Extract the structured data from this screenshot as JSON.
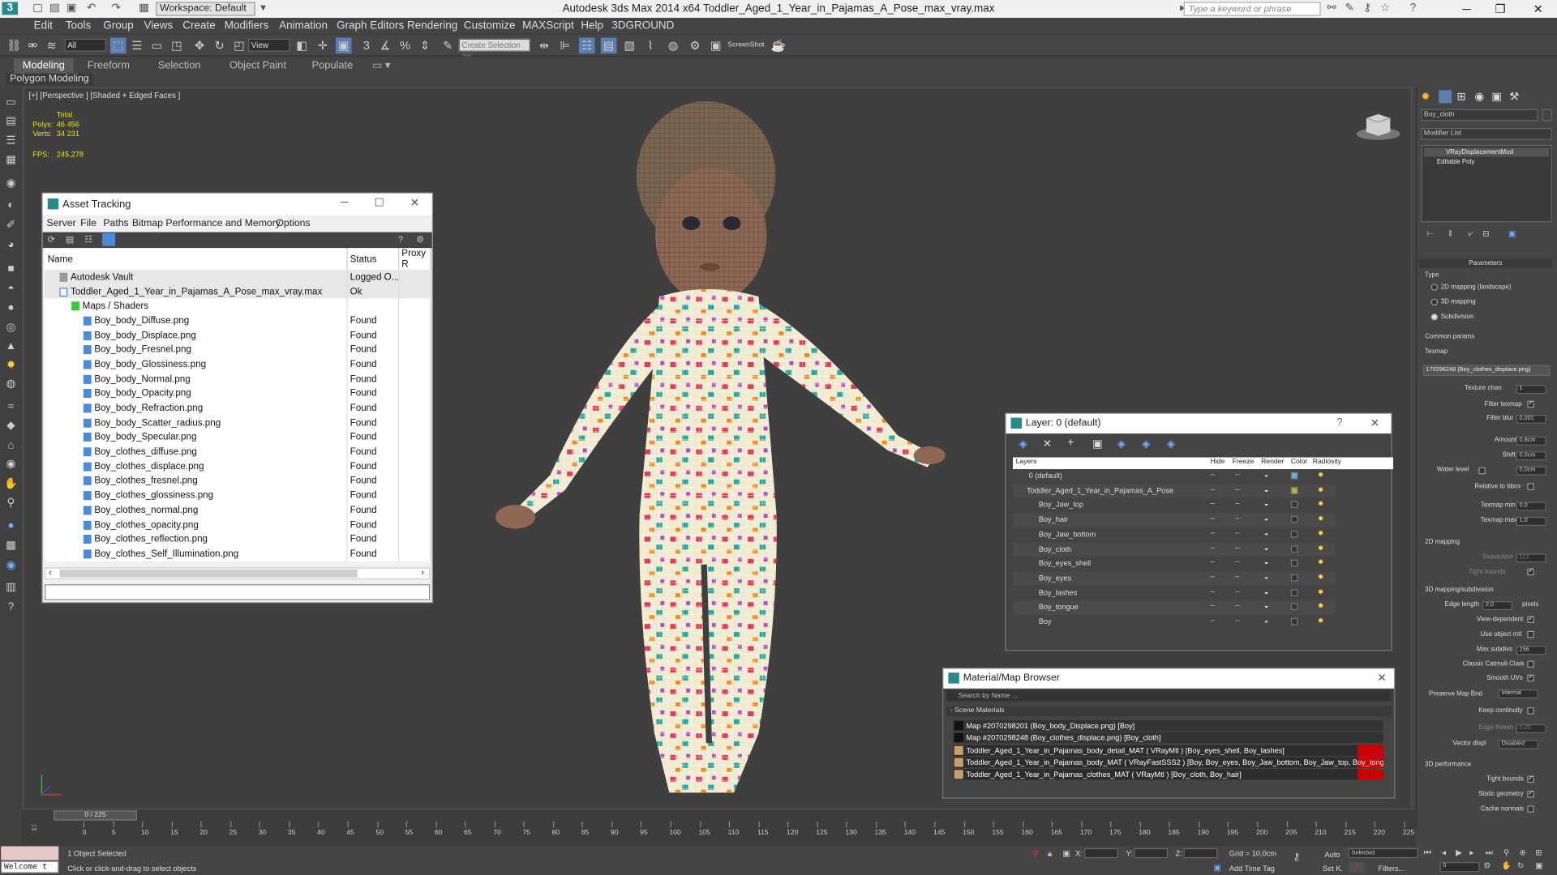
{
  "app": {
    "title": "Autodesk 3ds Max  2014 x64    Toddler_Aged_1_Year_in_Pajamas_A_Pose_max_vray.max",
    "workspace": "Workspace: Default",
    "search_placeholder": "Type a keyword or phrase"
  },
  "menu": [
    "Edit",
    "Tools",
    "Group",
    "Views",
    "Create",
    "Modifiers",
    "Animation",
    "Graph Editors",
    "Rendering",
    "Customize",
    "MAXScript",
    "Help",
    "3DGROUND"
  ],
  "toolbar": {
    "filter": "All",
    "refcoord": "View",
    "selset": "Create Selection Se",
    "screenshot": "ScreenShot"
  },
  "ribbon": {
    "tabs": [
      "Modeling",
      "Freeform",
      "Selection",
      "Object Paint",
      "Populate"
    ],
    "active": "Modeling",
    "sub": "Polygon Modeling"
  },
  "viewport": {
    "label": "[+] [Perspective ] [Shaded + Edged Faces ]",
    "stats": {
      "total": "Total",
      "polys_label": "Polys:",
      "polys": "46 456",
      "verts_label": "Verts:",
      "verts": "34 231",
      "fps_label": "FPS:",
      "fps": "245,278"
    }
  },
  "asset": {
    "title": "Asset Tracking",
    "menu": [
      "Server",
      "File",
      "Paths",
      "Bitmap Performance and Memory",
      "Options"
    ],
    "columns": [
      "Name",
      "Status",
      "Proxy R"
    ],
    "rows": [
      {
        "name": "Autodesk Vault",
        "status": "Logged O...",
        "indent": 1
      },
      {
        "name": "Toddler_Aged_1_Year_in_Pajamas_A_Pose_max_vray.max",
        "status": "Ok",
        "indent": 2
      },
      {
        "name": "Maps / Shaders",
        "status": "",
        "indent": 3
      },
      {
        "name": "Boy_body_Diffuse.png",
        "status": "Found",
        "indent": 4
      },
      {
        "name": "Boy_body_Displace.png",
        "status": "Found",
        "indent": 4
      },
      {
        "name": "Boy_body_Fresnel.png",
        "status": "Found",
        "indent": 4
      },
      {
        "name": "Boy_body_Glossiness.png",
        "status": "Found",
        "indent": 4
      },
      {
        "name": "Boy_body_Normal.png",
        "status": "Found",
        "indent": 4
      },
      {
        "name": "Boy_body_Opacity.png",
        "status": "Found",
        "indent": 4
      },
      {
        "name": "Boy_body_Refraction.png",
        "status": "Found",
        "indent": 4
      },
      {
        "name": "Boy_body_Scatter_radius.png",
        "status": "Found",
        "indent": 4
      },
      {
        "name": "Boy_body_Specular.png",
        "status": "Found",
        "indent": 4
      },
      {
        "name": "Boy_clothes_diffuse.png",
        "status": "Found",
        "indent": 4
      },
      {
        "name": "Boy_clothes_displace.png",
        "status": "Found",
        "indent": 4
      },
      {
        "name": "Boy_clothes_fresnel.png",
        "status": "Found",
        "indent": 4
      },
      {
        "name": "Boy_clothes_glossiness.png",
        "status": "Found",
        "indent": 4
      },
      {
        "name": "Boy_clothes_normal.png",
        "status": "Found",
        "indent": 4
      },
      {
        "name": "Boy_clothes_opacity.png",
        "status": "Found",
        "indent": 4
      },
      {
        "name": "Boy_clothes_reflection.png",
        "status": "Found",
        "indent": 4
      },
      {
        "name": "Boy_clothes_Self_Illumination.png",
        "status": "Found",
        "indent": 4
      }
    ]
  },
  "layer": {
    "title": "Layer: 0 (default)",
    "cols": [
      "Layers",
      "Hide",
      "Freeze",
      "Render",
      "Color",
      "Radiosity"
    ],
    "rows": [
      "0 (default)",
      "Toddler_Aged_1_Year_in_Pajamas_A_Pose",
      "Boy_Jaw_top",
      "Boy_hair",
      "Boy_Jaw_bottom",
      "Boy_cloth",
      "Boy_eyes_shell",
      "Boy_eyes",
      "Boy_lashes",
      "Boy_tongue",
      "Boy"
    ]
  },
  "matbrowser": {
    "title": "Material/Map Browser",
    "search": "Search by Name ...",
    "section": "- Scene Materials",
    "items": [
      "Map #2070298201 (Boy_body_Displace.png) [Boy]",
      "Map #2070298248 (Boy_clothes_displace.png) [Boy_cloth]",
      "Toddler_Aged_1_Year_in_Pajamas_body_detail_MAT ( VRayMtl ) [Boy_eyes_shell, Boy_lashes]",
      "Toddler_Aged_1_Year_in_Pajamas_body_MAT ( VRayFastSSS2 ) [Boy, Boy_eyes, Boy_Jaw_bottom, Boy_Jaw_top, Boy_tongue]",
      "Toddler_Aged_1_Year_in_Pajamas_clothes_MAT ( VRayMtl ) [Boy_cloth, Boy_hair]"
    ]
  },
  "cmdpanel": {
    "objname": "Boy_cloth",
    "modlist": "Modifier List",
    "stack": [
      "VRayDisplacementMod",
      "Editable Poly"
    ],
    "params": "Parameters",
    "type": "Type",
    "type_opts": [
      "2D mapping (landscape)",
      "3D mapping",
      "Subdivision"
    ],
    "common": "Common params",
    "texmap": "Texmap",
    "texmap_val": "170298248 (Boy_clothes_displace.png)",
    "texchan": "Texture chan",
    "texchan_val": "1",
    "filtertex": "Filter texmap",
    "filterblur": "Filter blur",
    "filterblur_val": "0,001",
    "amount": "Amount",
    "amount_val": "0,8cm",
    "shift": "Shift",
    "shift_val": "0,0cm",
    "waterlevel": "Water level",
    "waterlevel_val": "0,0cm",
    "relbbox": "Relative to bbox",
    "texmin": "Texmap min",
    "texmin_val": "0,0",
    "texmax": "Texmap max",
    "texmax_val": "1,0",
    "map2d": "2D mapping",
    "resolution": "Resolution",
    "resolution_val": "512",
    "tight": "Tight bounds",
    "map3d": "3D mapping/subdivision",
    "edgelen": "Edge length",
    "edgelen_val": "2,0",
    "pixels": "pixels",
    "viewdep": "View-dependent",
    "useobj": "Use object mtl",
    "maxsub": "Max subdivs",
    "maxsub_val": "256",
    "catmull": "Classic Catmull-Clark",
    "smoothuv": "Smooth UVs",
    "preserve": "Preserve Map Bnd",
    "preserve_val": "Internal",
    "keepcont": "Keep continuity",
    "edgethr": "Edge thresh",
    "edgethr_val": "0,05",
    "vecdisp": "Vector displ",
    "vecdisp_val": "Disabled",
    "perf": "3D performance",
    "tight2": "Tight bounds",
    "staticgeo": "Static geometry",
    "cachenorm": "Cache normals"
  },
  "timeline": {
    "slider": "0 / 225",
    "ticks": [
      "0",
      "5",
      "10",
      "15",
      "20",
      "25",
      "30",
      "35",
      "40",
      "45",
      "50",
      "55",
      "60",
      "65",
      "70",
      "75",
      "80",
      "85",
      "90",
      "95",
      "100",
      "105",
      "110",
      "115",
      "120",
      "125",
      "130",
      "135",
      "140",
      "145",
      "150",
      "155",
      "160",
      "165",
      "170",
      "175",
      "180",
      "185",
      "190",
      "195",
      "200",
      "205",
      "210",
      "215",
      "220",
      "225"
    ]
  },
  "status": {
    "welcome": "Welcome t",
    "selected": "1 Object Selected",
    "hint": "Click or click-and-drag to select objects",
    "x": "X:",
    "y": "Y:",
    "z": "Z:",
    "grid": "Grid = 10,0cm",
    "addtime": "Add Time Tag",
    "auto": "Auto",
    "setk": "Set K.",
    "mode": "Selected",
    "filters": "Filters...",
    "frame": "0"
  }
}
